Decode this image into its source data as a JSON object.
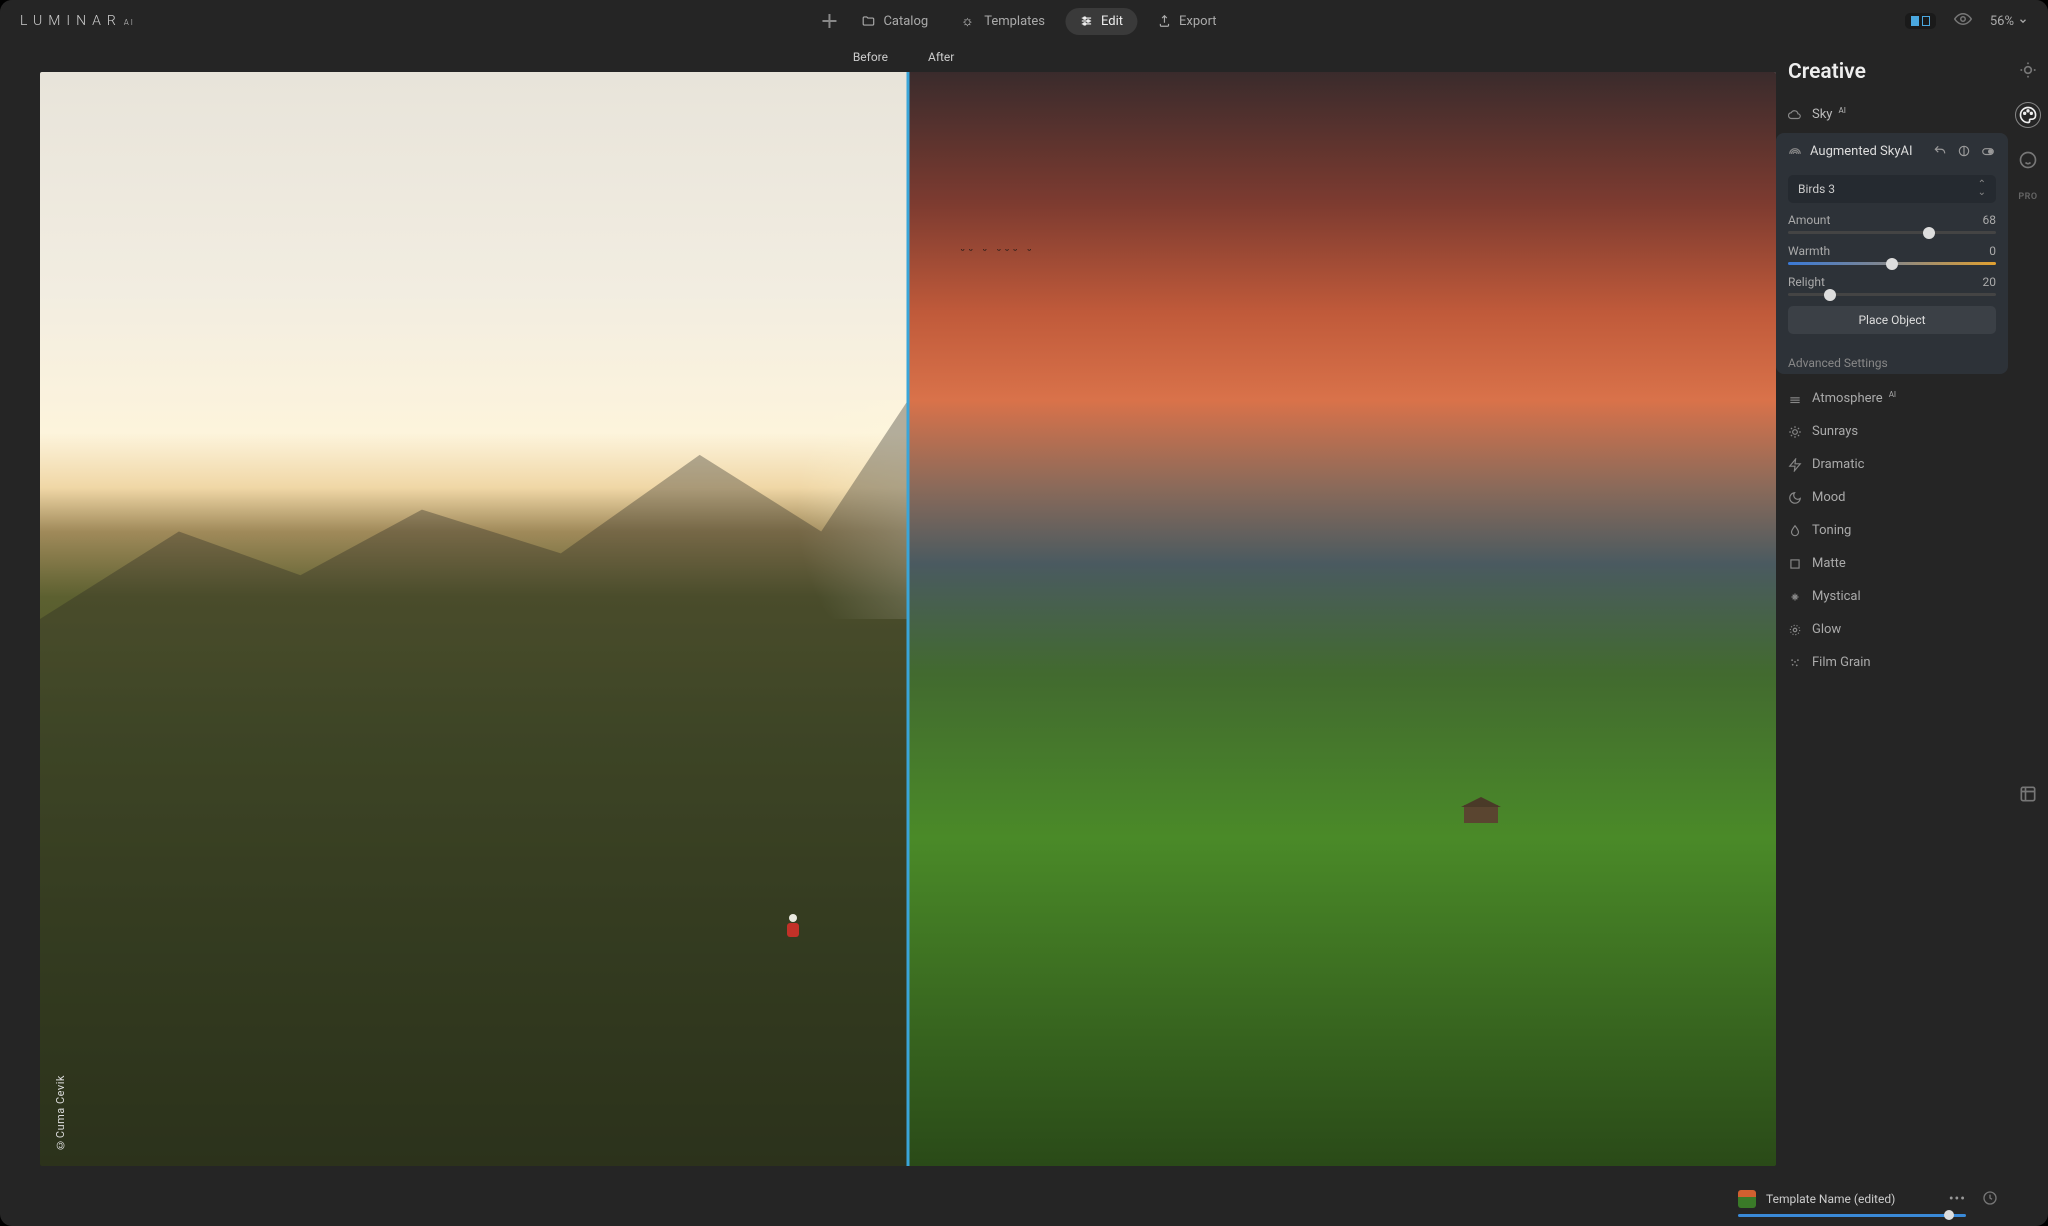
{
  "app": {
    "logo_main": "LUMINAR",
    "logo_sup": "AI"
  },
  "topnav": {
    "catalog": "Catalog",
    "templates": "Templates",
    "edit": "Edit",
    "export": "Export"
  },
  "topright": {
    "zoom": "56%"
  },
  "compare": {
    "before": "Before",
    "after": "After"
  },
  "credit": "©Cuma Cevik",
  "panel": {
    "title": "Creative",
    "sky": {
      "label": "Sky",
      "ai": "AI"
    },
    "augmented": {
      "label": "Augmented Sky",
      "ai": "AI",
      "preset": "Birds 3",
      "amount_label": "Amount",
      "amount_value": "68",
      "warmth_label": "Warmth",
      "warmth_value": "0",
      "relight_label": "Relight",
      "relight_value": "20",
      "place_btn": "Place Object",
      "advanced": "Advanced Settings"
    },
    "tools": {
      "atmosphere": "Atmosphere",
      "atmosphere_ai": "AI",
      "sunrays": "Sunrays",
      "dramatic": "Dramatic",
      "mood": "Mood",
      "toning": "Toning",
      "matte": "Matte",
      "mystical": "Mystical",
      "glow": "Glow",
      "filmgrain": "Film Grain"
    }
  },
  "footer": {
    "template_name": "Template Name (edited)"
  },
  "rail": {
    "pro": "PRO"
  }
}
